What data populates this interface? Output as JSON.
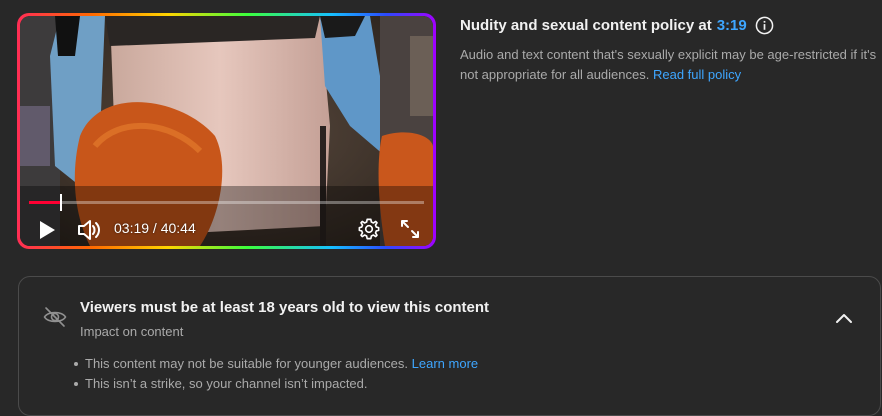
{
  "player": {
    "current_time": "03:19",
    "duration": "40:44",
    "time_display": "03:19 / 40:44",
    "progress": 0.081
  },
  "policy": {
    "title_prefix": "Nudity and sexual content policy at",
    "timestamp": "3:19",
    "description": "Audio and text content that's sexually explicit may be age-restricted if it's not appropriate for all audiences.",
    "read_policy_link": "Read full policy"
  },
  "restriction": {
    "title": "Viewers must be at least 18 years old to view this content",
    "subtitle": "Impact on content",
    "bullet1_text": "This content may not be suitable for younger audiences.",
    "bullet1_link": "Learn more",
    "bullet2_text": "This isn’t a strike, so your channel isn’t impacted."
  },
  "icons": {
    "play": "play-icon",
    "volume": "volume-icon",
    "settings": "gear-icon",
    "fullscreen": "fullscreen-icon",
    "info": "info-icon",
    "restricted": "eye-off-icon",
    "collapse": "chevron-up-icon"
  },
  "colors": {
    "accent_link": "#3ea6ff",
    "progress_red": "#ff0033",
    "background": "#282828"
  }
}
